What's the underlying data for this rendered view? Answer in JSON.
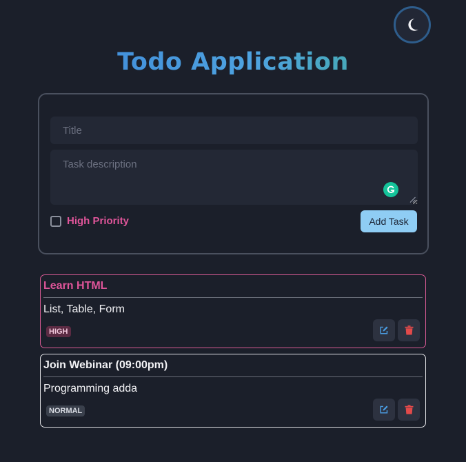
{
  "header": {
    "title": "Todo Application",
    "theme_toggle_icon": "moon-icon"
  },
  "form": {
    "title_placeholder": "Title",
    "description_placeholder": "Task description",
    "priority_label": "High Priority",
    "priority_checked": false,
    "add_button_label": "Add Task"
  },
  "tasks": [
    {
      "title": "Learn HTML",
      "description": "List, Table, Form",
      "priority": "HIGH"
    },
    {
      "title": "Join Webinar (09:00pm)",
      "description": "Programming adda",
      "priority": "NORMAL"
    }
  ],
  "colors": {
    "background": "#1b1f2a",
    "high_priority": "#e0559a",
    "add_button": "#8fcdf4",
    "edit_icon": "#4a9be0",
    "delete_icon": "#e24a4a"
  }
}
